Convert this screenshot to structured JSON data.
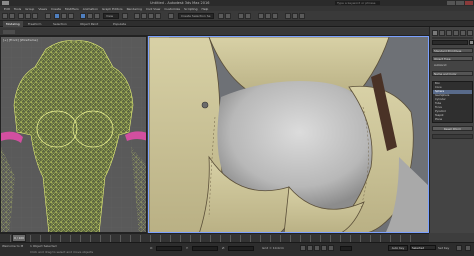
{
  "window": {
    "title": "Untitled - Autodesk 3ds Max 2016",
    "search_placeholder": "Type a keyword or phrase"
  },
  "menubar": {
    "items": [
      "Edit",
      "Tools",
      "Group",
      "Views",
      "Create",
      "Modifiers",
      "Animation",
      "Graph Editors",
      "Rendering",
      "Civil View",
      "Customize",
      "Scripting",
      "Help"
    ]
  },
  "toolbar": {
    "view_dropdown": "View",
    "selection_set": "Create Selection Se"
  },
  "subtoolbar": {
    "tabs": [
      "Modeling",
      "Freeform",
      "Selection",
      "Object Paint",
      "Populate"
    ],
    "active_tab": "Modeling"
  },
  "viewports": {
    "left_label": "[+] [Front] [Wireframe]",
    "right_label": ""
  },
  "command_panel": {
    "rollout_object_type": "Object Type",
    "autogrid_label": "AutoGrid",
    "list_items": [
      "Box",
      "Cone",
      "Sphere",
      "GeoSphere",
      "Cylinder",
      "Tube",
      "Torus",
      "Pyramid",
      "Teapot",
      "Plane"
    ],
    "selected_index": 2,
    "rollout_name_color": "Name and Color",
    "button_label": "Reset Xform",
    "dropdown_label": "Standard Primitives"
  },
  "timeline": {
    "frame_display": "0 / 100"
  },
  "statusbar": {
    "selection_info": "1 Object Selected",
    "prompt": "Click and drag to select and move objects",
    "welcome": "Welcome to M",
    "x_label": "X:",
    "y_label": "Y:",
    "z_label": "Z:",
    "grid_label": "Grid = 10.0cm",
    "autokey_label": "Auto Key",
    "selected_dropdown": "Selected",
    "setkey_label": "Set Key",
    "key_filters": "Key Filters..."
  }
}
